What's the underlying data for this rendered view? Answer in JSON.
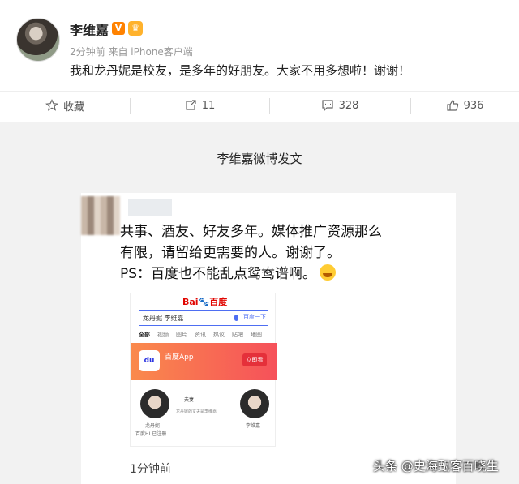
{
  "post": {
    "user_name": "李维嘉",
    "vip_badge": "V",
    "meta": "2分钟前  来自 iPhone客户端",
    "text": "我和龙丹妮是校友，是多年的好朋友。大家不用多想啦！谢谢！"
  },
  "actions": {
    "favorite_label": "收藏",
    "repost_count": "11",
    "comment_count": "328",
    "like_count": "936"
  },
  "caption": "李维嘉微博发文",
  "card": {
    "line1": "共事、酒友、好友多年。媒体推广资源那么",
    "line2": "有限，请留给更需要的人。谢谢了。",
    "line3": "PS：百度也不能乱点鸳鸯谱啊。",
    "time": "1分钟前",
    "baidu": {
      "logo_left": "Bai",
      "logo_right": "百度",
      "query": "龙丹妮 李维嘉",
      "search_button": "百度一下",
      "tabs": [
        "全部",
        "视频",
        "图片",
        "资讯",
        "热议",
        "贴吧",
        "地图"
      ],
      "app_name": "百度App",
      "app_button": "立即看",
      "person1": "龙丹妮",
      "person1_sub": "百度HI 已注册",
      "person2": "李维嘉",
      "relation": "夫妻",
      "relation_sub": "龙丹妮的丈夫是李维嘉"
    }
  },
  "watermark": "头条 @史海甄客百晓生"
}
